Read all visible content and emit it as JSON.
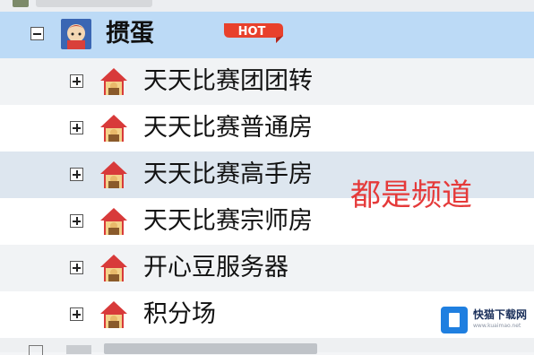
{
  "tree": {
    "parent": {
      "label": "掼蛋",
      "badge": "HOT",
      "expanded": true
    },
    "children": [
      {
        "label": "天天比赛团团转"
      },
      {
        "label": "天天比赛普通房"
      },
      {
        "label": "天天比赛高手房"
      },
      {
        "label": "天天比赛宗师房"
      },
      {
        "label": "开心豆服务器"
      },
      {
        "label": "积分场"
      }
    ]
  },
  "annotation": "都是频道",
  "watermark": {
    "name": "快猫下载网",
    "url": "www.kuaimao.net"
  },
  "colors": {
    "selected_row": "#bcdaf6",
    "annotation": "#e53a3a",
    "badge": "#e8412c"
  },
  "icons": {
    "collapse": "minus-box-icon",
    "expand": "plus-box-icon",
    "room": "house-icon",
    "game": "avatar-icon"
  }
}
